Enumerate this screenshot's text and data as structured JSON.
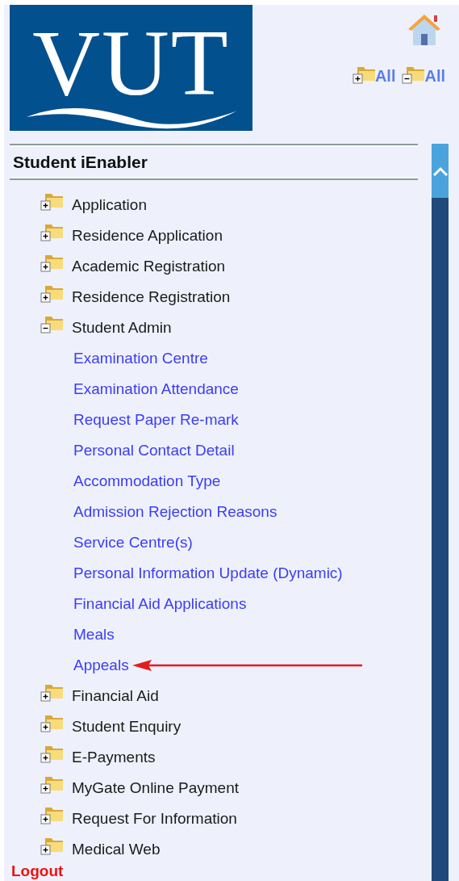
{
  "logo": {
    "text": "VUT"
  },
  "toolbar": {
    "expand_all": "All",
    "collapse_all": "All"
  },
  "menu": {
    "title": "Student iEnabler",
    "items": [
      {
        "label": "Application",
        "expanded": false
      },
      {
        "label": "Residence Application",
        "expanded": false
      },
      {
        "label": "Academic Registration",
        "expanded": false
      },
      {
        "label": "Residence Registration",
        "expanded": false
      },
      {
        "label": "Student Admin",
        "expanded": true,
        "children": [
          {
            "label": "Examination Centre",
            "marked": false
          },
          {
            "label": "Examination Attendance",
            "marked": false
          },
          {
            "label": "Request Paper Re-mark",
            "marked": false
          },
          {
            "label": "Personal Contact Detail",
            "marked": false
          },
          {
            "label": "Accommodation Type",
            "marked": false
          },
          {
            "label": "Admission Rejection Reasons",
            "marked": false
          },
          {
            "label": "Service Centre(s)",
            "marked": false
          },
          {
            "label": "Personal Information Update (Dynamic)",
            "marked": false
          },
          {
            "label": "Financial Aid Applications",
            "marked": false
          },
          {
            "label": "Meals",
            "marked": false
          },
          {
            "label": "Appeals",
            "marked": true
          }
        ]
      },
      {
        "label": "Financial Aid",
        "expanded": false
      },
      {
        "label": "Student Enquiry",
        "expanded": false
      },
      {
        "label": "E-Payments",
        "expanded": false
      },
      {
        "label": "MyGate Online Payment",
        "expanded": false
      },
      {
        "label": "Request For Information",
        "expanded": false
      },
      {
        "label": "Medical Web",
        "expanded": false
      }
    ],
    "logout": "Logout"
  }
}
